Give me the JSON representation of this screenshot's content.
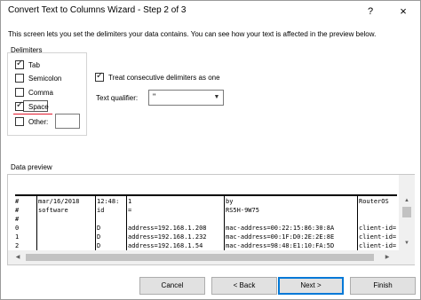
{
  "window": {
    "title": "Convert Text to Columns Wizard - Step 2 of 3",
    "help_glyph": "?",
    "close_glyph": "×"
  },
  "description": "This screen lets you set the delimiters your data contains.  You can see how your text is affected in the preview below.",
  "delimiters": {
    "group_label": "Delimiters",
    "items": [
      {
        "label": "Tab",
        "checked": true
      },
      {
        "label": "Semicolon",
        "checked": false
      },
      {
        "label": "Comma",
        "checked": false
      },
      {
        "label": "Space",
        "checked": true
      },
      {
        "label": "Other:",
        "checked": false
      }
    ],
    "other_value": ""
  },
  "options": {
    "treat_consecutive_label": "Treat consecutive delimiters as one",
    "treat_consecutive_checked": true,
    "text_qualifier_label": "Text qualifier:",
    "text_qualifier_value": "\""
  },
  "preview": {
    "label": "Data preview",
    "rows": [
      [
        "#",
        "mar/16/2018",
        "12:48:",
        "1",
        "by",
        "RouterOS"
      ],
      [
        "#",
        "software",
        "id",
        "=",
        "RS5H-9W75",
        ""
      ],
      [
        "#",
        "",
        "",
        "",
        "",
        ""
      ],
      [
        "0",
        "",
        "D",
        "address=192.168.1.208",
        "mac-address=00:22:15:86:30:8A",
        "client-id="
      ],
      [
        "1",
        "",
        "D",
        "address=192.168.1.232",
        "mac-address=00:1F:D0:2E:2E:8E",
        "client-id="
      ],
      [
        "2",
        "",
        "D",
        "address=192.168.1.54",
        "mac-address=98:48:E1:10:FA:5D",
        "client-id="
      ]
    ]
  },
  "buttons": {
    "cancel": "Cancel",
    "back": "< Back",
    "next": "Next >",
    "finish": "Finish"
  },
  "colors": {
    "accent": "#0078d7",
    "highlight_underline": "#e0182c"
  },
  "icons": {
    "check": "check-icon",
    "dropdown": "chevron-down-icon",
    "scroll_up": "arrow-up-icon",
    "scroll_down": "arrow-down-icon",
    "scroll_left": "arrow-left-icon",
    "scroll_right": "arrow-right-icon"
  }
}
